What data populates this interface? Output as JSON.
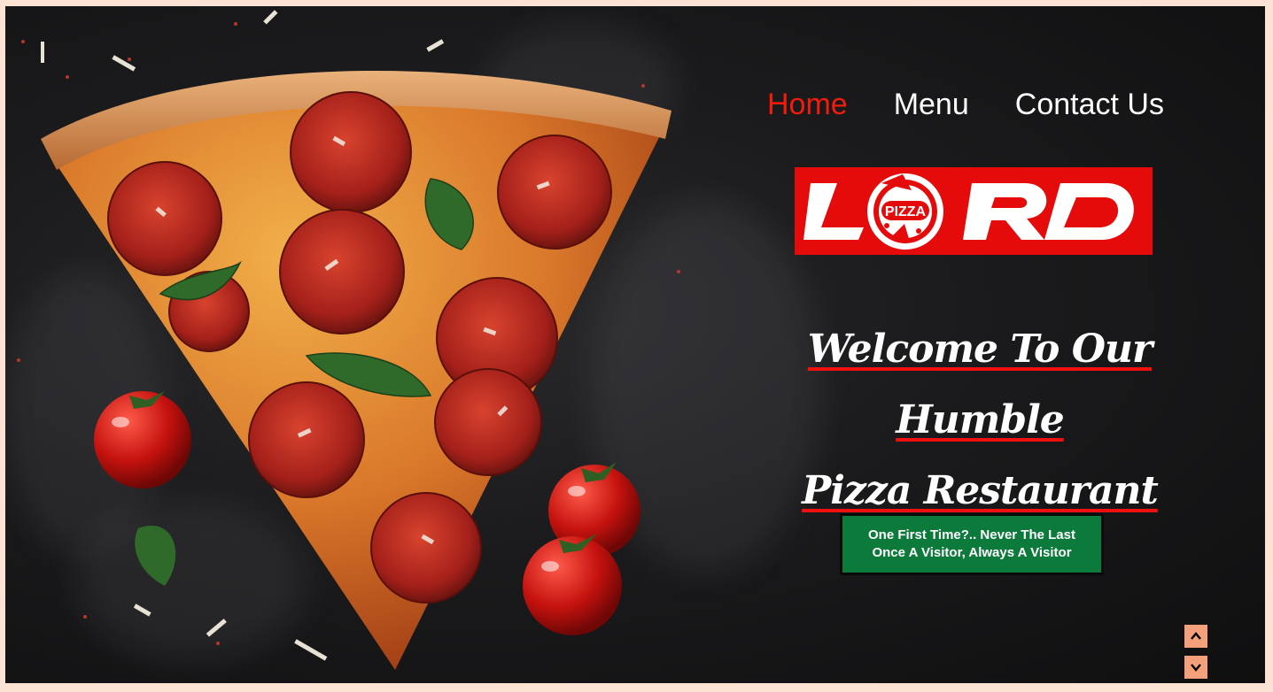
{
  "nav": {
    "items": [
      {
        "label": "Home",
        "active": true
      },
      {
        "label": "Menu",
        "active": false
      },
      {
        "label": "Contact Us",
        "active": false
      }
    ]
  },
  "logo": {
    "text_left": "L",
    "badge": "PIZZA",
    "text_right": "RD",
    "background": "#e50b0b"
  },
  "headline": {
    "line1": "Welcome To Our Humble",
    "line2": "Pizza Restaurant"
  },
  "cta": {
    "line1": "One First Time?.. Never The Last",
    "line2": "Once A Visitor, Always A Visitor",
    "background": "#0c7a3b"
  },
  "scroll": {
    "up_icon": "chevron-up-icon",
    "down_icon": "chevron-down-icon",
    "color": "#f4a07a"
  },
  "colors": {
    "accent": "#f21c0c",
    "page_border": "#fde3d4"
  }
}
